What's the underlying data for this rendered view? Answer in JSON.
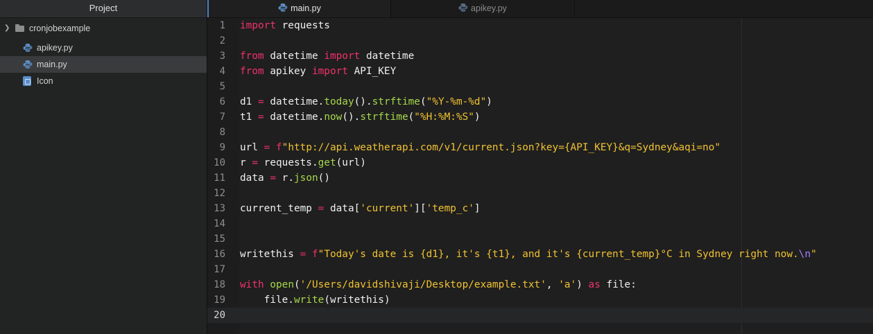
{
  "sidebar": {
    "title": "Project",
    "folder": "cronjobexample",
    "files": [
      {
        "label": "apikey.py",
        "icon": "python-icon"
      },
      {
        "label": "main.py",
        "icon": "python-icon",
        "selected": true
      },
      {
        "label": "Icon",
        "icon": "finder-icon"
      }
    ]
  },
  "tabs": [
    {
      "label": "main.py",
      "active": true
    },
    {
      "label": "apikey.py",
      "active": false
    }
  ],
  "editor": {
    "current_line": 20,
    "lines": [
      {
        "n": "1",
        "t": [
          [
            "kw",
            "import"
          ],
          [
            "plain",
            " requests"
          ]
        ]
      },
      {
        "n": "2",
        "t": []
      },
      {
        "n": "3",
        "t": [
          [
            "kw",
            "from"
          ],
          [
            "plain",
            " datetime "
          ],
          [
            "kw",
            "import"
          ],
          [
            "plain",
            " datetime"
          ]
        ]
      },
      {
        "n": "4",
        "t": [
          [
            "kw",
            "from"
          ],
          [
            "plain",
            " apikey "
          ],
          [
            "kw",
            "import"
          ],
          [
            "plain",
            " API_KEY"
          ]
        ]
      },
      {
        "n": "5",
        "t": []
      },
      {
        "n": "6",
        "t": [
          [
            "plain",
            "d1 "
          ],
          [
            "op",
            "="
          ],
          [
            "plain",
            " datetime."
          ],
          [
            "fn",
            "today"
          ],
          [
            "plain",
            "()."
          ],
          [
            "fn",
            "strftime"
          ],
          [
            "plain",
            "("
          ],
          [
            "str",
            "\"%Y-%m-%d\""
          ],
          [
            "plain",
            ")"
          ]
        ]
      },
      {
        "n": "7",
        "t": [
          [
            "plain",
            "t1 "
          ],
          [
            "op",
            "="
          ],
          [
            "plain",
            " datetime."
          ],
          [
            "fn",
            "now"
          ],
          [
            "plain",
            "()."
          ],
          [
            "fn",
            "strftime"
          ],
          [
            "plain",
            "("
          ],
          [
            "str",
            "\"%H:%M:%S\""
          ],
          [
            "plain",
            ")"
          ]
        ]
      },
      {
        "n": "8",
        "t": []
      },
      {
        "n": "9",
        "t": [
          [
            "plain",
            "url "
          ],
          [
            "op",
            "="
          ],
          [
            "plain",
            " "
          ],
          [
            "kw",
            "f"
          ],
          [
            "str",
            "\"http://api.weatherapi.com/v1/current.json?key={API_KEY}&q=Sydney&aqi=no\""
          ]
        ]
      },
      {
        "n": "10",
        "t": [
          [
            "plain",
            "r "
          ],
          [
            "op",
            "="
          ],
          [
            "plain",
            " requests."
          ],
          [
            "fn",
            "get"
          ],
          [
            "plain",
            "(url)"
          ]
        ]
      },
      {
        "n": "11",
        "t": [
          [
            "plain",
            "data "
          ],
          [
            "op",
            "="
          ],
          [
            "plain",
            " r."
          ],
          [
            "fn",
            "json"
          ],
          [
            "plain",
            "()"
          ]
        ]
      },
      {
        "n": "12",
        "t": []
      },
      {
        "n": "13",
        "t": [
          [
            "plain",
            "current_temp "
          ],
          [
            "op",
            "="
          ],
          [
            "plain",
            " data["
          ],
          [
            "str",
            "'current'"
          ],
          [
            "plain",
            "]["
          ],
          [
            "str",
            "'temp_c'"
          ],
          [
            "plain",
            "]"
          ]
        ]
      },
      {
        "n": "14",
        "t": []
      },
      {
        "n": "15",
        "t": []
      },
      {
        "n": "16",
        "t": [
          [
            "plain",
            "writethis "
          ],
          [
            "op",
            "="
          ],
          [
            "plain",
            " "
          ],
          [
            "kw",
            "f"
          ],
          [
            "str",
            "\"Today's date is {d1}, it's {t1}, and it's {current_temp}°C in Sydney right now."
          ],
          [
            "esc",
            "\\n"
          ],
          [
            "str",
            "\""
          ]
        ]
      },
      {
        "n": "17",
        "t": []
      },
      {
        "n": "18",
        "t": [
          [
            "kw",
            "with"
          ],
          [
            "plain",
            " "
          ],
          [
            "fn",
            "open"
          ],
          [
            "plain",
            "("
          ],
          [
            "str",
            "'/Users/davidshivaji/Desktop/example.txt'"
          ],
          [
            "plain",
            ", "
          ],
          [
            "str",
            "'a'"
          ],
          [
            "plain",
            ") "
          ],
          [
            "kw",
            "as"
          ],
          [
            "plain",
            " file:"
          ]
        ]
      },
      {
        "n": "19",
        "t": [
          [
            "plain",
            "    file."
          ],
          [
            "fn",
            "write"
          ],
          [
            "plain",
            "(writethis)"
          ]
        ]
      },
      {
        "n": "20",
        "t": []
      }
    ]
  }
}
